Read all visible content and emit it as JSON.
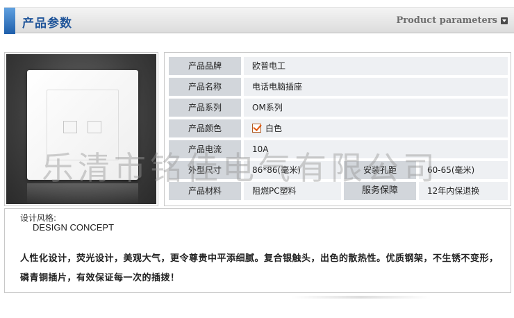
{
  "header": {
    "title": "产品参数",
    "subtitle": "Product parameters"
  },
  "photo": {
    "alt": "white wall plate with two sockets"
  },
  "params": {
    "brand_label": "产品品牌",
    "brand_value": "欧普电工",
    "name_label": "产品名称",
    "name_value": "电话电脑插座",
    "series_label": "产品系列",
    "series_value": "OM系列",
    "color_label": "产品颜色",
    "color_value": "白色",
    "current_label": "产品电流",
    "current_value": "10A",
    "size_label": "外型尺寸",
    "size_value": "86*86(毫米)",
    "hole_label": "安装孔距",
    "hole_value": "60-65(毫米)",
    "material_label": "产品材料",
    "material_value": "阻燃PC塑料",
    "warranty_label": "服务保障",
    "warranty_value": "12年内保退换"
  },
  "watermark": "乐清市铭佳电气有限公司",
  "concept": {
    "title": "设计风格:",
    "subtitle": "DESIGN CONCEPT",
    "body": "人性化设计，荧光设计，美观大气，更令尊贵中平添细腻。复合银触头，出色的散热性。优质钢架，不生锈不变形，磷青铜插片，有效保证每一次的插拨！"
  },
  "colors": {
    "accent": "#1f5499",
    "label_bg": "#d2d6db",
    "value_bg": "#eef0f3"
  }
}
